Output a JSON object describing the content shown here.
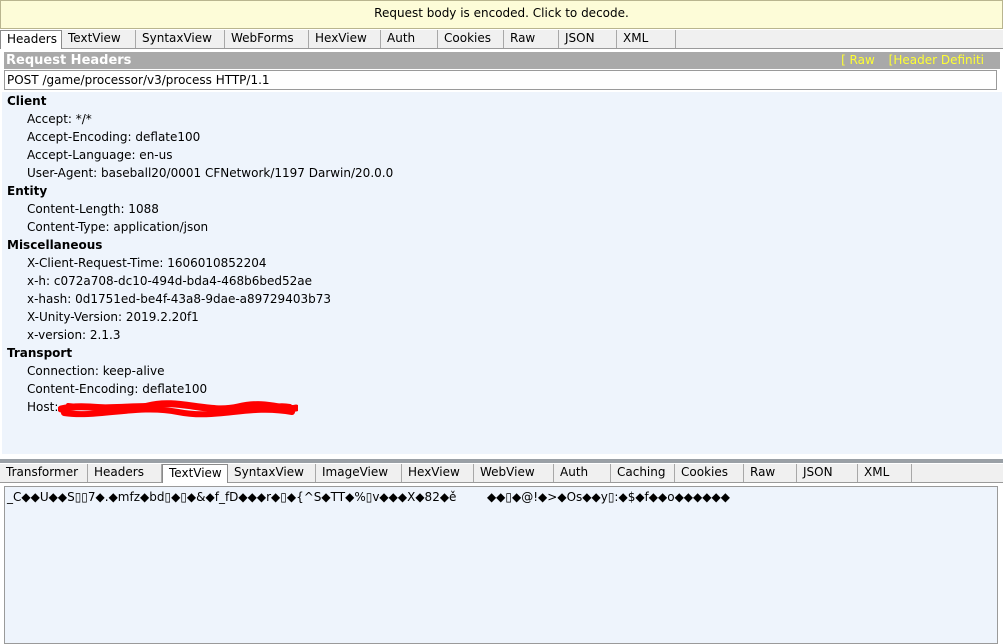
{
  "notice": "Request body is encoded. Click to decode.",
  "top_tabs": [
    {
      "label": "Headers",
      "active": true
    },
    {
      "label": "TextView"
    },
    {
      "label": "SyntaxView"
    },
    {
      "label": "WebForms"
    },
    {
      "label": "HexView"
    },
    {
      "label": "Auth"
    },
    {
      "label": "Cookies"
    },
    {
      "label": "Raw"
    },
    {
      "label": "JSON"
    },
    {
      "label": "XML"
    }
  ],
  "section": {
    "title": "Request Headers",
    "link_raw": "[ Raw",
    "link_defs": "[Header Definiti"
  },
  "request_line": "POST /game/processor/v3/process HTTP/1.1",
  "groups": [
    {
      "name": "Client",
      "items": [
        "Accept: */*",
        "Accept-Encoding: deflate100",
        "Accept-Language: en-us",
        "User-Agent: baseball20/0001 CFNetwork/1197 Darwin/20.0.0"
      ]
    },
    {
      "name": "Entity",
      "items": [
        "Content-Length: 1088",
        "Content-Type: application/json"
      ]
    },
    {
      "name": "Miscellaneous",
      "items": [
        "X-Client-Request-Time: 1606010852204",
        "x-h: c072a708-dc10-494d-bda4-468b6bed52ae",
        "x-hash: 0d1751ed-be4f-43a8-9dae-a89729403b73",
        "X-Unity-Version: 2019.2.20f1",
        "x-version: 2.1.3"
      ]
    },
    {
      "name": "Transport",
      "items": [
        "Connection: keep-alive",
        "Content-Encoding: deflate100",
        "Host:"
      ]
    }
  ],
  "bottom_tabs": [
    {
      "label": "Transformer"
    },
    {
      "label": "Headers"
    },
    {
      "label": "TextView",
      "active": true
    },
    {
      "label": "SyntaxView"
    },
    {
      "label": "ImageView"
    },
    {
      "label": "HexView"
    },
    {
      "label": "WebView"
    },
    {
      "label": "Auth"
    },
    {
      "label": "Caching"
    },
    {
      "label": "Cookies"
    },
    {
      "label": "Raw"
    },
    {
      "label": "JSON"
    },
    {
      "label": "XML"
    }
  ],
  "body_text": "_C◆◆U◆◆S▯▯7◆.◆mfz◆bd▯◆▯◆&◆f_fD◆◆◆r◆▯◆{^S◆TT◆%▯v◆◆◆X◆82◆ě        ◆◆▯◆@!◆>◆Os◆◆y▯:◆$◆f◆◆o◆◆◆◆◆◆",
  "colors": {
    "redaction": "#ff0000",
    "link": "#ffff33",
    "pane_bg": "#eef4fc"
  }
}
